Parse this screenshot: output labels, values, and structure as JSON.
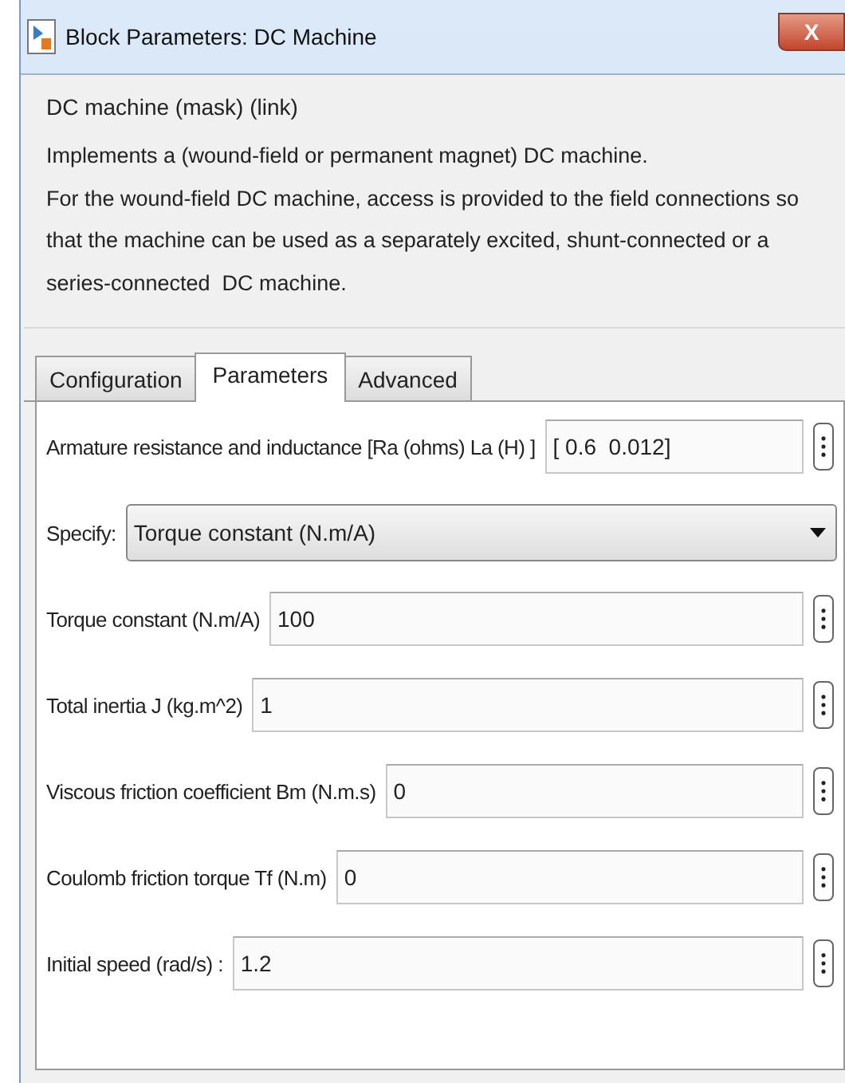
{
  "window": {
    "title": "Block Parameters: DC Machine",
    "close": "X"
  },
  "group": {
    "title": "DC machine (mask) (link)",
    "description": [
      "Implements a (wound-field or permanent magnet) DC machine.",
      "For the wound-field DC machine, access is provided to the field connections so",
      "that the machine can be used as a separately excited, shunt-connected or a",
      "series-connected  DC machine."
    ]
  },
  "tabs": [
    {
      "label": "Configuration",
      "selected": false
    },
    {
      "label": "Parameters",
      "selected": true
    },
    {
      "label": "Advanced",
      "selected": false
    }
  ],
  "parameters": [
    {
      "kind": "text",
      "label": "Armature resistance and inductance [Ra (ohms) La (H) ]",
      "value": "[ 0.6  0.012]"
    },
    {
      "kind": "dropdown",
      "label": "Specify:",
      "value": "Torque constant (N.m/A)"
    },
    {
      "kind": "text",
      "label": "Torque constant (N.m/A)",
      "value": "100"
    },
    {
      "kind": "text",
      "label": "Total inertia J (kg.m^2)",
      "value": "1"
    },
    {
      "kind": "text",
      "label": "Viscous friction coefficient Bm (N.m.s)",
      "value": "0"
    },
    {
      "kind": "text",
      "label": "Coulomb friction torque Tf (N.m)",
      "value": "0"
    },
    {
      "kind": "text",
      "label": "Initial speed (rad/s) :",
      "value": "1.2"
    }
  ]
}
